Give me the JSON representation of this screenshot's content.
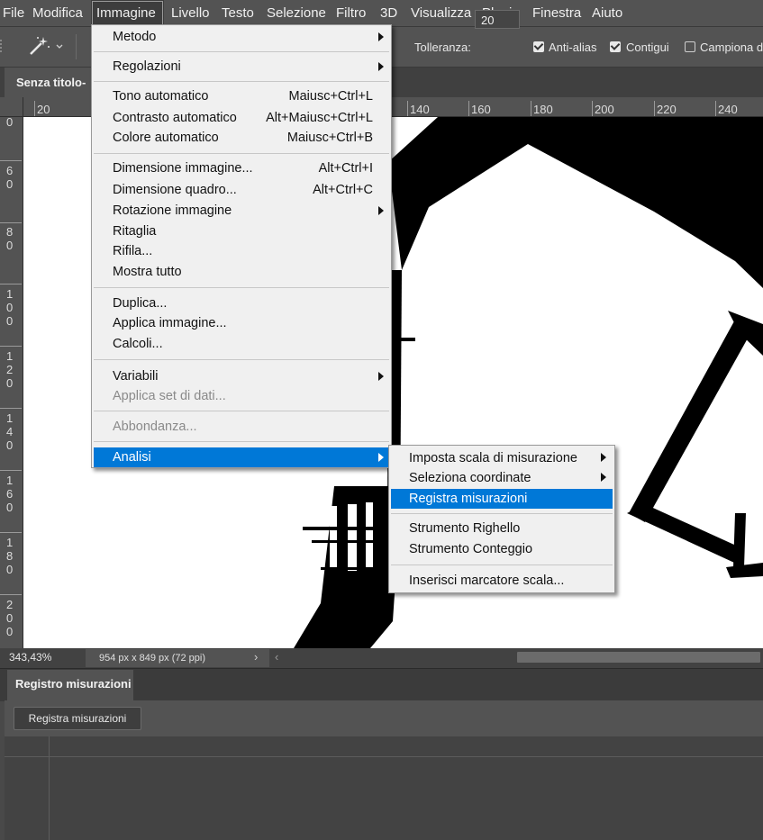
{
  "menubar": {
    "items": [
      "File",
      "Modifica",
      "Immagine",
      "Livello",
      "Testo",
      "Selezione",
      "Filtro",
      "3D",
      "Visualizza",
      "Plugin",
      "Finestra",
      "Aiuto"
    ],
    "active": "Immagine"
  },
  "options": {
    "tolerance_label": "Tolleranza:",
    "tolerance_value": "20",
    "antialias_label": "Anti-alias",
    "antialias_checked": true,
    "contiguous_label": "Contigui",
    "contiguous_checked": true,
    "sample_label": "Campiona da",
    "sample_checked": false
  },
  "document": {
    "tab_title": "Senza titolo-"
  },
  "rulers": {
    "horizontal": [
      "20",
      "140",
      "160",
      "180",
      "200",
      "220",
      "240"
    ],
    "vertical": [
      [
        "0"
      ],
      [
        "6",
        "0"
      ],
      [
        "8",
        "0"
      ],
      [
        "1",
        "0",
        "0"
      ],
      [
        "1",
        "2",
        "0"
      ],
      [
        "1",
        "4",
        "0"
      ],
      [
        "1",
        "6",
        "0"
      ],
      [
        "1",
        "8",
        "0"
      ],
      [
        "2",
        "0",
        "0"
      ]
    ]
  },
  "statusbar": {
    "zoom": "343,43%",
    "docinfo": "954 px x 849 px (72 ppi)"
  },
  "image_menu": {
    "items": [
      {
        "label": "Metodo",
        "submenu": true
      },
      {
        "label": "Regolazioni",
        "submenu": true
      },
      {
        "label": "Tono automatico",
        "shortcut": "Maiusc+Ctrl+L"
      },
      {
        "label": "Contrasto automatico",
        "shortcut": "Alt+Maiusc+Ctrl+L"
      },
      {
        "label": "Colore automatico",
        "shortcut": "Maiusc+Ctrl+B"
      },
      {
        "label": "Dimensione immagine...",
        "shortcut": "Alt+Ctrl+I"
      },
      {
        "label": "Dimensione quadro...",
        "shortcut": "Alt+Ctrl+C"
      },
      {
        "label": "Rotazione immagine",
        "submenu": true
      },
      {
        "label": "Ritaglia"
      },
      {
        "label": "Rifila..."
      },
      {
        "label": "Mostra tutto"
      },
      {
        "label": "Duplica..."
      },
      {
        "label": "Applica immagine..."
      },
      {
        "label": "Calcoli..."
      },
      {
        "label": "Variabili",
        "submenu": true
      },
      {
        "label": "Applica set di dati...",
        "disabled": true
      },
      {
        "label": "Abbondanza...",
        "disabled": true
      },
      {
        "label": "Analisi",
        "submenu": true,
        "highlighted": true
      }
    ]
  },
  "analysis_submenu": {
    "items": [
      {
        "label": "Imposta scala di misurazione",
        "submenu": true
      },
      {
        "label": "Seleziona coordinate",
        "submenu": true
      },
      {
        "label": "Registra misurazioni",
        "highlighted": true
      },
      {
        "label": "Strumento Righello"
      },
      {
        "label": "Strumento Conteggio"
      },
      {
        "label": "Inserisci marcatore scala..."
      }
    ]
  },
  "panel": {
    "tab_title": "Registro misurazioni",
    "record_button": "Registra misurazioni"
  }
}
